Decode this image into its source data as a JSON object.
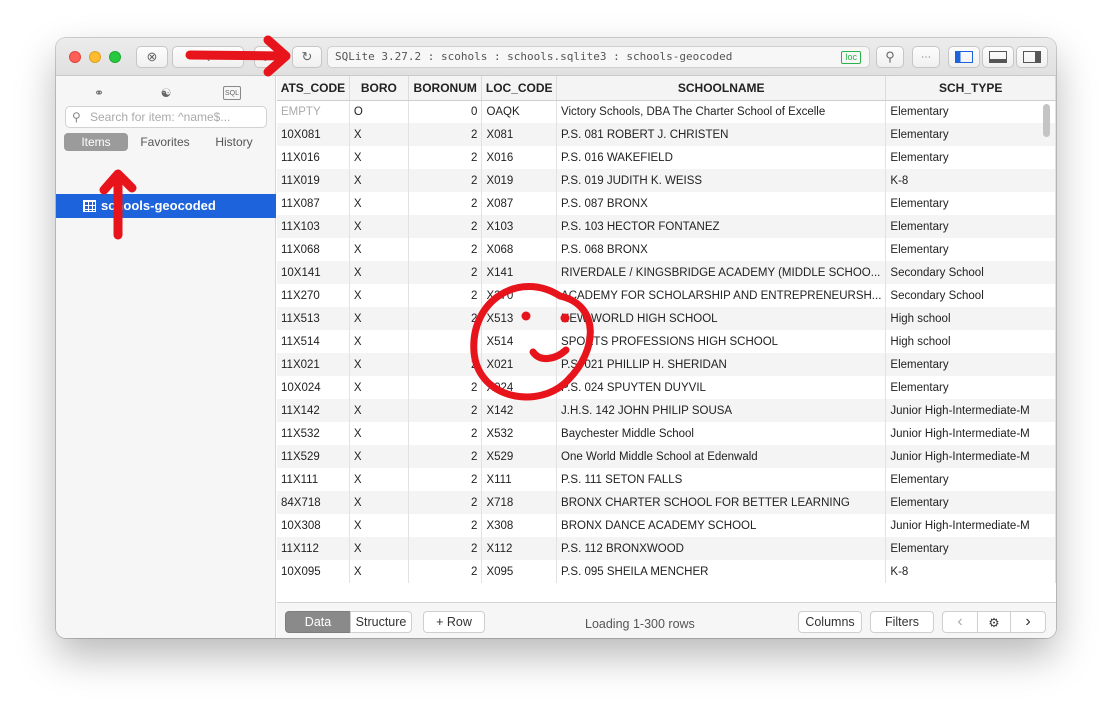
{
  "toolbar": {
    "connection": "SQLite 3.27.2 : scohols : schools.sqlite3 : schools-geocoded",
    "badge": "loc"
  },
  "sidebar": {
    "search_placeholder": "Search for item: ^name$...",
    "tabs": [
      "Items",
      "Favorites",
      "History"
    ],
    "selected_item": "schools-geocoded"
  },
  "table": {
    "columns": [
      "ATS_CODE",
      "BORO",
      "BORONUM",
      "LOC_CODE",
      "SCHOOLNAME",
      "SCH_TYPE"
    ],
    "rows": [
      [
        "EMPTY",
        "O",
        "0",
        "OAQK",
        "Victory Schools, DBA The Charter School of Excelle",
        "Elementary"
      ],
      [
        "10X081",
        "X",
        "2",
        "X081",
        "P.S. 081 ROBERT J. CHRISTEN",
        "Elementary"
      ],
      [
        "11X016",
        "X",
        "2",
        "X016",
        "P.S. 016 WAKEFIELD",
        "Elementary"
      ],
      [
        "11X019",
        "X",
        "2",
        "X019",
        "P.S. 019 JUDITH K. WEISS",
        "K-8"
      ],
      [
        "11X087",
        "X",
        "2",
        "X087",
        "P.S. 087 BRONX",
        "Elementary"
      ],
      [
        "11X103",
        "X",
        "2",
        "X103",
        "P.S. 103 HECTOR FONTANEZ",
        "Elementary"
      ],
      [
        "11X068",
        "X",
        "2",
        "X068",
        "P.S. 068 BRONX",
        "Elementary"
      ],
      [
        "10X141",
        "X",
        "2",
        "X141",
        "RIVERDALE / KINGSBRIDGE ACADEMY (MIDDLE SCHOO...",
        "Secondary School"
      ],
      [
        "11X270",
        "X",
        "2",
        "X270",
        "ACADEMY FOR SCHOLARSHIP AND ENTREPRENEURSH...",
        "Secondary School"
      ],
      [
        "11X513",
        "X",
        "2",
        "X513",
        "NEW WORLD HIGH SCHOOL",
        "High school"
      ],
      [
        "11X514",
        "X",
        "2",
        "X514",
        "SPORTS PROFESSIONS HIGH SCHOOL",
        "High school"
      ],
      [
        "11X021",
        "X",
        "2",
        "X021",
        "P.S. 021 PHILLIP H. SHERIDAN",
        "Elementary"
      ],
      [
        "10X024",
        "X",
        "2",
        "X024",
        "P.S. 024 SPUYTEN DUYVIL",
        "Elementary"
      ],
      [
        "11X142",
        "X",
        "2",
        "X142",
        "J.H.S. 142 JOHN PHILIP SOUSA",
        "Junior High-Intermediate-M"
      ],
      [
        "11X532",
        "X",
        "2",
        "X532",
        "Baychester Middle School",
        "Junior High-Intermediate-M"
      ],
      [
        "11X529",
        "X",
        "2",
        "X529",
        "One World Middle School at Edenwald",
        "Junior High-Intermediate-M"
      ],
      [
        "11X111",
        "X",
        "2",
        "X111",
        "P.S. 111 SETON FALLS",
        "Elementary"
      ],
      [
        "84X718",
        "X",
        "2",
        "X718",
        "BRONX CHARTER SCHOOL FOR BETTER LEARNING",
        "Elementary"
      ],
      [
        "10X308",
        "X",
        "2",
        "X308",
        "BRONX DANCE ACADEMY SCHOOL",
        "Junior High-Intermediate-M"
      ],
      [
        "11X112",
        "X",
        "2",
        "X112",
        "P.S. 112 BRONXWOOD",
        "Elementary"
      ],
      [
        "10X095",
        "X",
        "2",
        "X095",
        "P.S. 095 SHEILA MENCHER",
        "K-8"
      ]
    ]
  },
  "bottombar": {
    "data": "Data",
    "structure": "Structure",
    "row": "+ Row",
    "status": "Loading 1-300 rows",
    "columns": "Columns",
    "filters": "Filters"
  },
  "colors": {
    "selection": "#1d63dc",
    "annotation": "#e8141c",
    "badge": "#2ab14a"
  }
}
